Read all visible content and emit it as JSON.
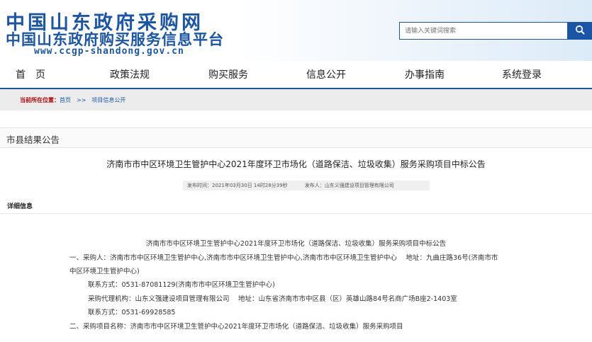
{
  "header": {
    "title_line1": "中国山东政府采购网",
    "title_line2": "中国山东政府购买服务信息平台",
    "url": "www.ccgp-shandong.gov.cn"
  },
  "search": {
    "placeholder": "请输入关键词搜索",
    "icon": "search-icon"
  },
  "nav": {
    "items": [
      "首　页",
      "政策法规",
      "购买服务",
      "信息公开",
      "办事指南",
      "系统登录"
    ]
  },
  "breadcrumb": {
    "label": "当前所在位置：",
    "home": "首页",
    "separator": ">>",
    "current": "项目信息公开"
  },
  "section": {
    "title": "市县结果公告"
  },
  "notice": {
    "title": "济南市市中区环境卫生管护中心2021年度环卫市场化（道路保洁、垃圾收集）服务采购项目中标公告",
    "publish_time_label": "发布时间：",
    "publish_time": "2021年03月30日 14时28分39秒",
    "publisher_label": "发布人：",
    "publisher": "山东义强建设项目管理有限公司"
  },
  "detail": {
    "heading": "详细信息",
    "body_title": "济南市市中区环境卫生管护中心2021年度环卫市场化（道路保洁、垃圾收集）服务采购项目中标公告",
    "lines": [
      "一、采购人：济南市市中区环境卫生管护中心,济南市市中区环境卫生管护中心,济南市市中区环境卫生管护中心　  地址：九曲庄路36号(济南市市",
      "中区环境卫生管护中心)",
      "联系方式：0531-87081129(济南市市中区环境卫生管护中心)",
      "采购代理机构：山东义强建设项目管理有限公司　  地址：山东省济南市市中区县（区）英雄山路84号名商广场B座2-1403室",
      "联系方式：0531-69928585",
      "二、采购项目名称：济南市市中区环境卫生管护中心2021年度环卫市场化（道路保洁、垃圾收集）服务采购项目"
    ]
  },
  "colors": {
    "brand_blue": "#1b56a6",
    "breadcrumb_red": "#b30000",
    "breadcrumb_bg": "#ececec"
  }
}
